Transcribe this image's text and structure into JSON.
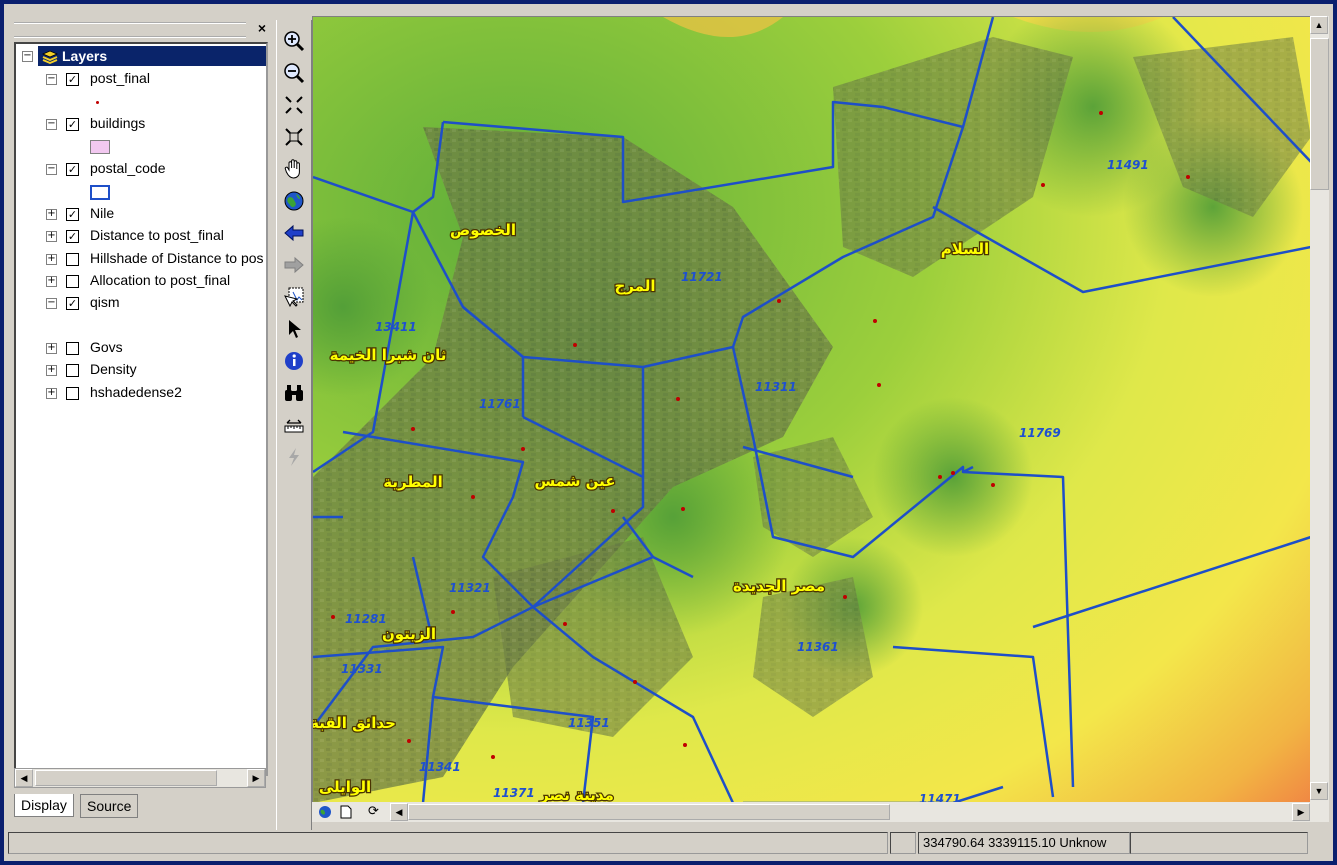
{
  "toc": {
    "root_label": "Layers",
    "close_glyph": "×",
    "layers": [
      {
        "label": "post_final",
        "expanded": true,
        "checked": true
      },
      {
        "label": "buildings",
        "expanded": true,
        "checked": true
      },
      {
        "label": "postal_code",
        "expanded": true,
        "checked": true
      },
      {
        "label": "Nile",
        "expanded": false,
        "checked": true
      },
      {
        "label": "Distance to post_final",
        "expanded": false,
        "checked": true
      },
      {
        "label": "Hillshade of Distance to pos",
        "expanded": false,
        "checked": false
      },
      {
        "label": "Allocation to post_final",
        "expanded": false,
        "checked": false
      },
      {
        "label": "qism",
        "expanded": true,
        "checked": true
      },
      {
        "label": "Govs",
        "expanded": false,
        "checked": false
      },
      {
        "label": "Density",
        "expanded": false,
        "checked": false
      },
      {
        "label": "hshadedense2",
        "expanded": false,
        "checked": false
      }
    ],
    "tabs": {
      "display": "Display",
      "source": "Source"
    }
  },
  "tools": [
    "zoom-in-icon",
    "zoom-out-icon",
    "fixed-zoom-in-icon",
    "fixed-zoom-out-icon",
    "pan-hand-icon",
    "full-extent-globe-icon",
    "back-arrow-icon",
    "forward-arrow-icon",
    "select-features-icon",
    "select-pointer-icon",
    "identify-icon",
    "find-binoculars-icon",
    "measure-icon",
    "hyperlink-lightning-icon"
  ],
  "map": {
    "district_labels": {
      "khosous": "الخصوص",
      "marg": "المرج",
      "salam": "السلام",
      "shubra": "ثان شبرا الخيمة",
      "ain_shams": "عين شمس",
      "matariya": "المطرية",
      "misr_gedida": "مصر الجديدة",
      "zeitoun": "الزيتون",
      "hadaek": "حدائق القبة",
      "waily": "الوايلى",
      "nasr": "مدينة نصر"
    },
    "postal_codes": {
      "c11721": "11721",
      "c11491": "11491",
      "c13411": "13411",
      "c11311": "11311",
      "c11761": "11761",
      "c11769": "11769",
      "c11321": "11321",
      "c11281": "11281",
      "c11361": "11361",
      "c11331": "11331",
      "c11351": "11351",
      "c11341": "11341",
      "c11371": "11371",
      "c11471": "11471"
    },
    "colors": {
      "boundary": "#1e4fc8",
      "green": "#6fbf3a",
      "yellow": "#e8e84a",
      "orange": "#f0a040",
      "red": "#ee4040"
    }
  },
  "status": {
    "coordinates": "334790.64  3339115.10 Unknow"
  }
}
